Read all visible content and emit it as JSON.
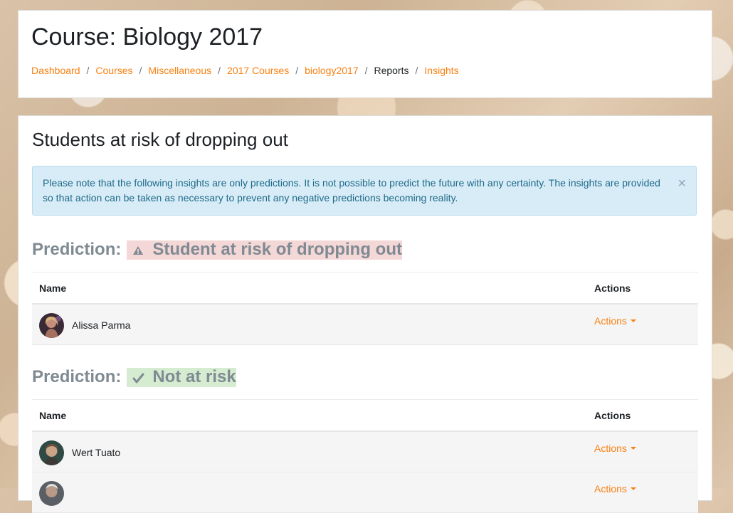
{
  "header": {
    "title": "Course: Biology 2017",
    "breadcrumb": [
      {
        "label": "Dashboard",
        "link": true
      },
      {
        "label": "Courses",
        "link": true
      },
      {
        "label": "Miscellaneous",
        "link": true
      },
      {
        "label": "2017 Courses",
        "link": true
      },
      {
        "label": "biology2017",
        "link": true
      },
      {
        "label": "Reports",
        "link": false
      },
      {
        "label": "Insights",
        "link": true
      }
    ],
    "separator": "/"
  },
  "main": {
    "title": "Students at risk of dropping out",
    "alert": {
      "text": "Please note that the following insights are only predictions. It is not possible to predict the future with any certainty. The insights are provided so that action can be taken as necessary to prevent any negative predictions becoming reality.",
      "close": "×"
    },
    "predictions": [
      {
        "prefix": "Prediction:",
        "label": "Student at risk of dropping out",
        "icon": "warning-icon",
        "color": "#f4d7d7",
        "columns": {
          "name": "Name",
          "actions": "Actions"
        },
        "rows": [
          {
            "name": "Alissa Parma",
            "actions": "Actions"
          }
        ]
      },
      {
        "prefix": "Prediction:",
        "label": "Not at risk",
        "icon": "check-icon",
        "color": "#d6ecd1",
        "columns": {
          "name": "Name",
          "actions": "Actions"
        },
        "rows": [
          {
            "name": "Wert Tuato",
            "actions": "Actions"
          },
          {
            "name": "",
            "actions": "Actions"
          }
        ]
      }
    ]
  },
  "colors": {
    "accent": "#f98012",
    "text": "#1d2125",
    "muted": "#7f8a92"
  }
}
